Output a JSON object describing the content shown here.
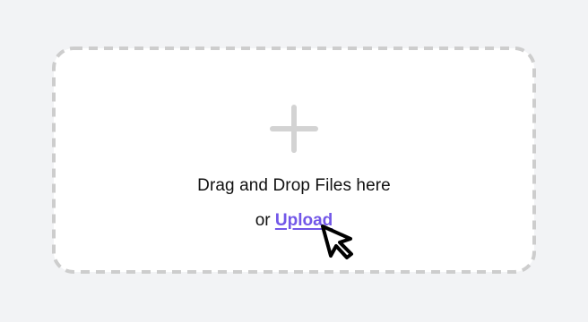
{
  "dropzone": {
    "plus_icon": "plus-icon",
    "instruction": "Drag and Drop Files here",
    "or_label": "or",
    "upload_label": "Upload"
  },
  "cursor_icon": "pointer-arrow-icon",
  "colors": {
    "background": "#f2f3f5",
    "panel": "#ffffff",
    "dashed_border": "#cdcdcd",
    "plus": "#d3d3d3",
    "link": "#7257e8",
    "text": "#111111"
  }
}
